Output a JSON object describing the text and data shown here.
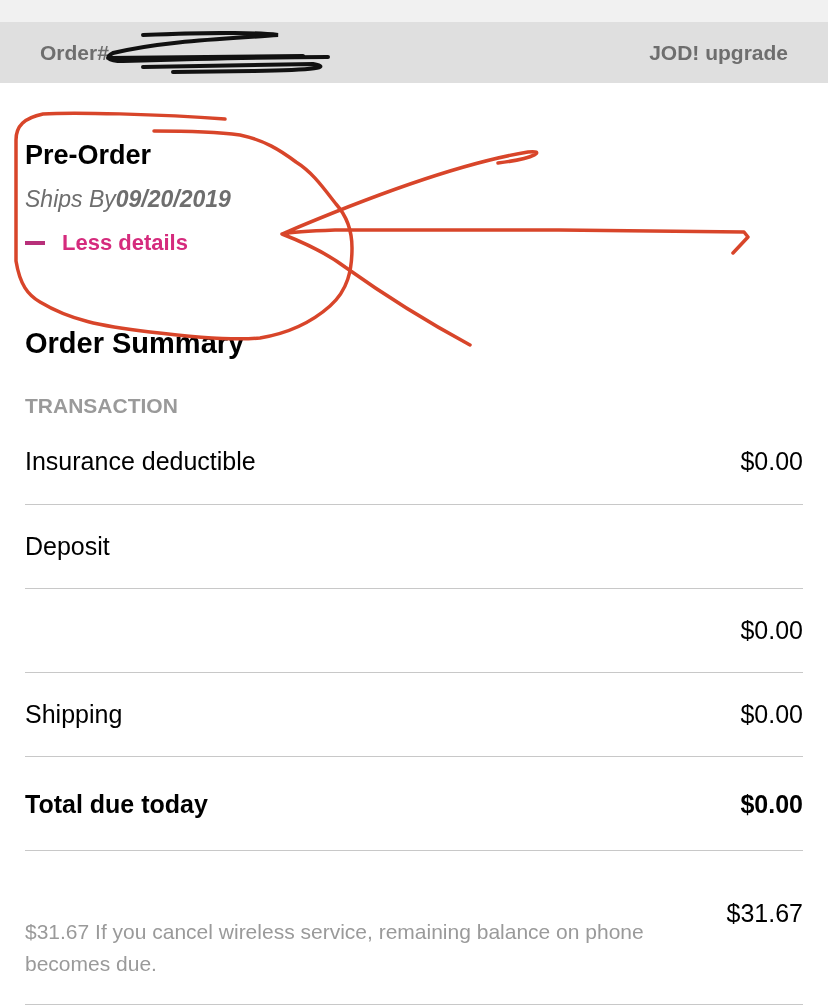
{
  "header": {
    "order_label": "Order#",
    "number_redacted": true,
    "link": "JOD! upgrade"
  },
  "preorder": {
    "title": "Pre-Order",
    "ships_by": "Ships By**09/20/2019**",
    "details_toggle": {
      "label": "Less details",
      "expanded": true
    }
  },
  "summary": {
    "title": "Order Summary",
    "section": "TRANSACTION",
    "rows": [
      {
        "kind": "line",
        "label": "Insurance deductible",
        "amount": "$0.00"
      },
      {
        "kind": "line",
        "label": "Deposit"
      },
      {
        "kind": "line",
        "amount": "$0.00"
      },
      {
        "kind": "line",
        "label": "Shipping",
        "amount": "$0.00"
      },
      {
        "kind": "total",
        "label": "Total due today",
        "amount": "$0.00"
      },
      {
        "kind": "note",
        "note": "$31.67 If you cancel wireless service, remaining balance on phone becomes due.",
        "amount": "$31.67"
      }
    ]
  },
  "markup": {
    "circle": true,
    "arrow": true
  }
}
